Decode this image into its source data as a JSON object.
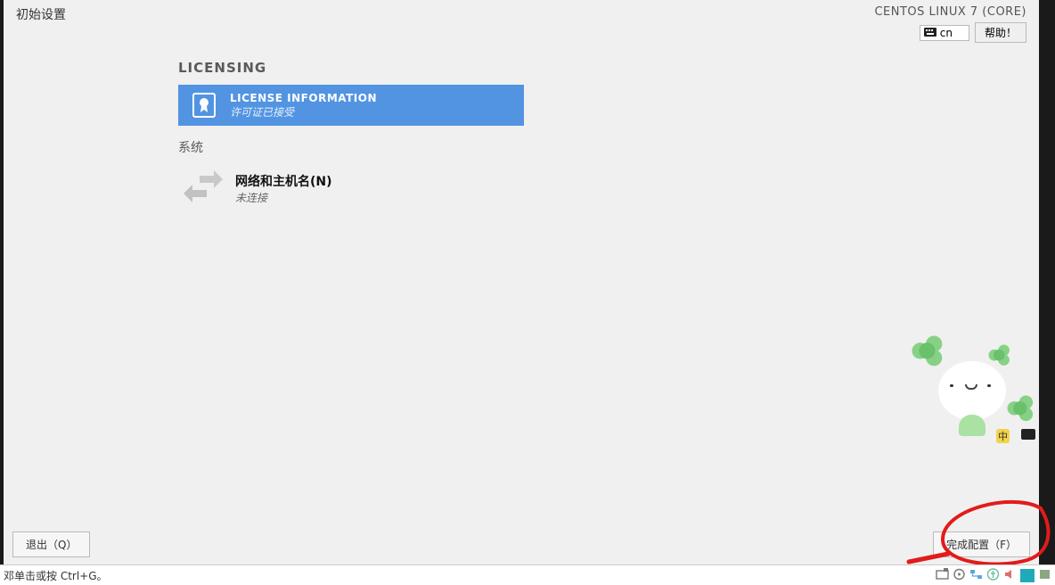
{
  "header": {
    "title": "初始设置",
    "os": "CENTOS LINUX 7 (CORE)",
    "lang_code": "cn",
    "help_label": "帮助！"
  },
  "sections": {
    "licensing": {
      "heading": "LICENSING",
      "card_title": "LICENSE INFORMATION",
      "card_status": "许可证已接受"
    },
    "system": {
      "heading": "系统",
      "network_title": "网络和主机名(N)",
      "network_status": "未连接"
    }
  },
  "mascot_tag": "中",
  "footer": {
    "quit_label": "退出（Q）",
    "finish_label": "完成配置（F）"
  },
  "statusbar": {
    "hint": "邓单击或按 Ctrl+G。"
  }
}
